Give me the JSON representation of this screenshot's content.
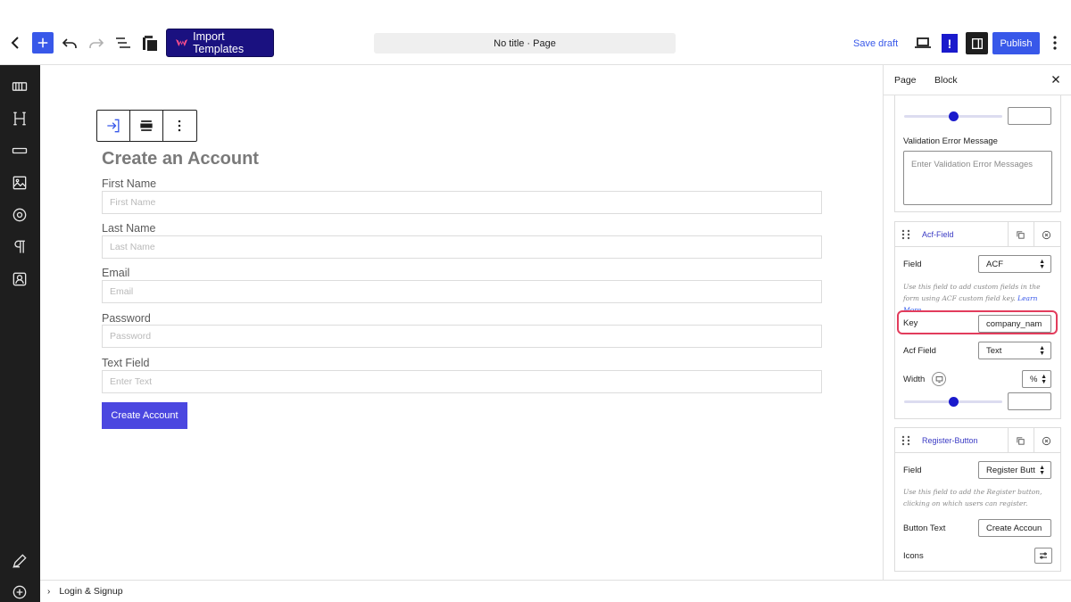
{
  "toolbar": {
    "import_templates": "Import Templates",
    "document_title": "No title · Page",
    "save_draft": "Save draft",
    "alert_badge": "!",
    "publish": "Publish"
  },
  "icons": {
    "back": "chevron-left-icon",
    "add": "plus-icon",
    "undo": "undo-icon",
    "redo": "redo-icon",
    "list_view": "list-view-icon",
    "clipboard": "clipboard-icon",
    "preview": "laptop-icon",
    "settings": "sidebar-toggle-icon",
    "options": "kebab-menu-icon"
  },
  "left_rail": {
    "items": [
      "columns-icon",
      "heading-icon",
      "separator-icon",
      "image-icon",
      "circle-icon",
      "paragraph-icon",
      "user-card-icon"
    ],
    "bottom_items": [
      "pencil-icon",
      "plus-circle-icon"
    ]
  },
  "canvas": {
    "form_title": "Create an Account",
    "fields": [
      {
        "label": "First Name",
        "placeholder": "First Name"
      },
      {
        "label": "Last Name",
        "placeholder": "Last Name"
      },
      {
        "label": "Email",
        "placeholder": "Email"
      },
      {
        "label": "Password",
        "placeholder": "Password"
      },
      {
        "label": "Text Field",
        "placeholder": "Enter Text"
      }
    ],
    "submit_label": "Create Account"
  },
  "footer": {
    "breadcrumb": "Login & Signup"
  },
  "panel": {
    "tabs": [
      "Page",
      "Block"
    ],
    "validation": {
      "label": "Validation Error Message",
      "placeholder": "Enter Validation Error Messages"
    },
    "acf_card": {
      "title": "Acf-Field",
      "field_label": "Field",
      "field_value": "ACF",
      "help_text": "Use this field to add custom fields in the form using ACF custom field key.",
      "help_link": "Learn More",
      "key_label": "Key",
      "key_value": "company_nam",
      "acf_field_label": "Acf Field",
      "acf_field_value": "Text",
      "width_label": "Width",
      "width_unit": "%",
      "width_level": 0.5
    },
    "register_card": {
      "title": "Register-Button",
      "field_label": "Field",
      "field_value": "Register Butt",
      "help_text": "Use this field to add the Register button, clicking on which users can register.",
      "button_text_label": "Button Text",
      "button_text_value": "Create Accoun",
      "icons_label": "Icons"
    },
    "top_slider_level": 0.5
  },
  "colors": {
    "accent": "#3858e9",
    "import_bg": "#1a1180",
    "submit_bg": "#4b47e0",
    "highlight": "#e23c5c"
  }
}
